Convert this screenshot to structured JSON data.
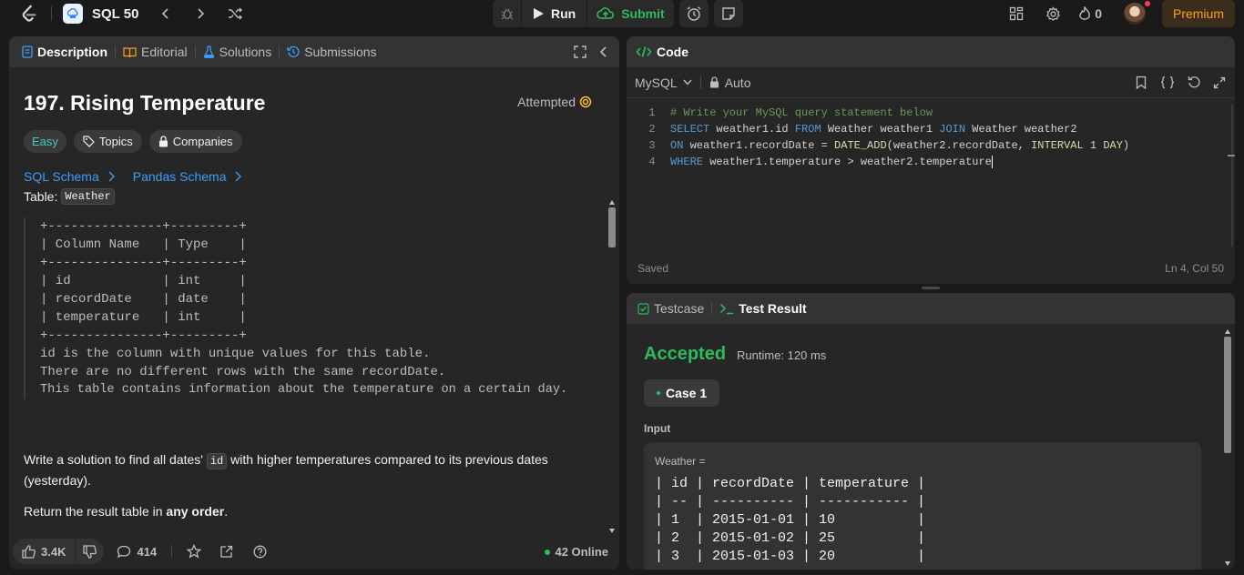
{
  "topbar": {
    "problem_list_title": "SQL 50",
    "run_label": "Run",
    "submit_label": "Submit",
    "streak_count": "0",
    "premium_label": "Premium"
  },
  "description_panel": {
    "tabs": [
      {
        "label": "Description"
      },
      {
        "label": "Editorial"
      },
      {
        "label": "Solutions"
      },
      {
        "label": "Submissions"
      }
    ],
    "title": "197. Rising Temperature",
    "status": "Attempted",
    "difficulty": "Easy",
    "topics_label": "Topics",
    "companies_label": "Companies",
    "sql_schema_link": "SQL Schema",
    "pandas_schema_link": "Pandas Schema",
    "table_label": "Table:",
    "table_name": "Weather",
    "schema_lines": [
      "+---------------+---------+",
      "| Column Name   | Type    |",
      "+---------------+---------+",
      "| id            | int     |",
      "| recordDate    | date    |",
      "| temperature   | int     |",
      "+---------------+---------+",
      "id is the column with unique values for this table.",
      "There are no different rows with the same recordDate.",
      "This table contains information about the temperature on a certain day."
    ],
    "task_before": "Write a solution to find all dates'",
    "task_code": "id",
    "task_after": "with higher temperatures compared to its previous dates (yesterday).",
    "return_before": "Return the result table in",
    "return_bold": "any order",
    "return_after": ".",
    "likes": "3.4K",
    "comments": "414",
    "online": "42 Online"
  },
  "code_panel": {
    "title": "Code",
    "language": "MySQL",
    "auto_label": "Auto",
    "line_numbers": [
      "1",
      "2",
      "3",
      "4"
    ],
    "saved_label": "Saved",
    "cursor_position": "Ln 4, Col 50"
  },
  "result_panel": {
    "testcase_tab": "Testcase",
    "result_tab": "Test Result",
    "verdict": "Accepted",
    "runtime": "Runtime: 120 ms",
    "case_label": "Case 1",
    "input_label": "Input",
    "input_name": "Weather =",
    "table_lines": [
      "| id | recordDate | temperature |",
      "| -- | ---------- | ----------- |",
      "| 1  | 2015-01-01 | 10          |",
      "| 2  | 2015-01-02 | 25          |",
      "| 3  | 2015-01-03 | 20          |"
    ]
  },
  "colors": {
    "accent_orange": "#ffa116",
    "submit_green": "#2cbb5d",
    "easy_teal": "#46c6c2",
    "link_blue": "#3b9dff",
    "tab_blue": "#3b9dff"
  }
}
